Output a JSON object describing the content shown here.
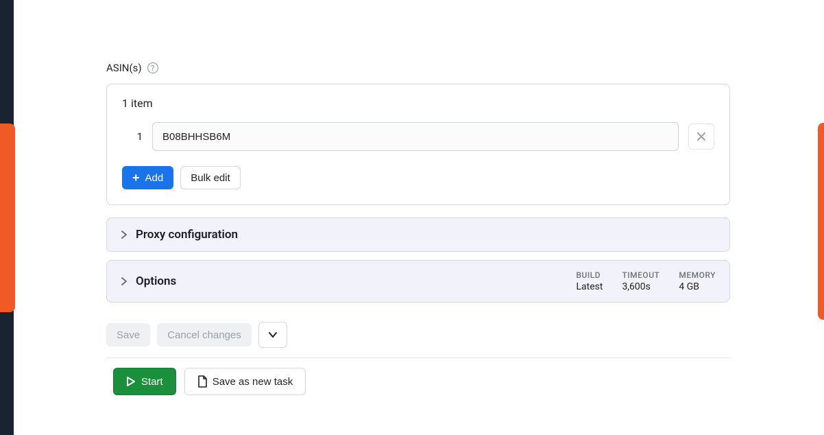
{
  "field": {
    "label": "ASIN(s)",
    "help_tooltip": "?"
  },
  "asin_card": {
    "count_text": "1 item",
    "items": [
      {
        "index": "1",
        "value": "B08BHHSB6M"
      }
    ],
    "add_label": "Add",
    "bulk_edit_label": "Bulk edit"
  },
  "accordions": {
    "proxy": {
      "title": "Proxy configuration"
    },
    "options": {
      "title": "Options",
      "meta": {
        "build": {
          "label": "BUILD",
          "value": "Latest"
        },
        "timeout": {
          "label": "TIMEOUT",
          "value": "3,600s"
        },
        "memory": {
          "label": "MEMORY",
          "value": "4 GB"
        }
      }
    }
  },
  "actions": {
    "save": "Save",
    "cancel": "Cancel changes",
    "start": "Start",
    "save_as_new": "Save as new task"
  }
}
